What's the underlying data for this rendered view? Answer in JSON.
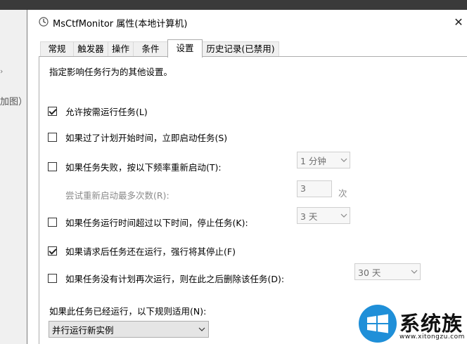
{
  "backdrop": {
    "partial_text": "加图）",
    "glyph": "›"
  },
  "window": {
    "title": "MsCtfMonitor 属性(本地计算机)",
    "close_glyph": "✕"
  },
  "tabs": [
    {
      "label": "常规"
    },
    {
      "label": "触发器"
    },
    {
      "label": "操作"
    },
    {
      "label": "条件"
    },
    {
      "label": "设置",
      "active": true
    },
    {
      "label": "历史记录(已禁用)"
    }
  ],
  "settings": {
    "description": "指定影响任务行为的其他设置。",
    "allow_on_demand": {
      "label": "允许按需运行任务(L)",
      "checked": true
    },
    "run_asap_if_missed": {
      "label": "如果过了计划开始时间，立即启动任务(S)",
      "checked": false
    },
    "restart_on_failure": {
      "label": "如果任务失败，按以下频率重新启动(T):",
      "checked": false,
      "interval": "1 分钟"
    },
    "restart_attempts": {
      "label": "尝试重新启动最多次数(R):",
      "value": "3",
      "unit": "次"
    },
    "stop_if_runs_longer": {
      "label": "如果任务运行时间超过以下时间，停止任务(K):",
      "checked": false,
      "duration": "3 天"
    },
    "force_stop": {
      "label": "如果请求后任务还在运行，强行将其停止(F)",
      "checked": true
    },
    "delete_if_not_scheduled": {
      "label": "如果任务没有计划再次运行，则在此之后删除该任务(D):",
      "checked": false,
      "delay": "30 天"
    },
    "running_rule": {
      "label": "如果此任务已经运行，以下规则适用(N):",
      "selected": "并行运行新实例"
    }
  },
  "watermark": {
    "text": "系统族",
    "url": "www.xitongzu.com"
  },
  "colors": {
    "accent": "#1f8fd8",
    "disabled_text": "#8a8a8a",
    "tab_border": "#adadad"
  }
}
